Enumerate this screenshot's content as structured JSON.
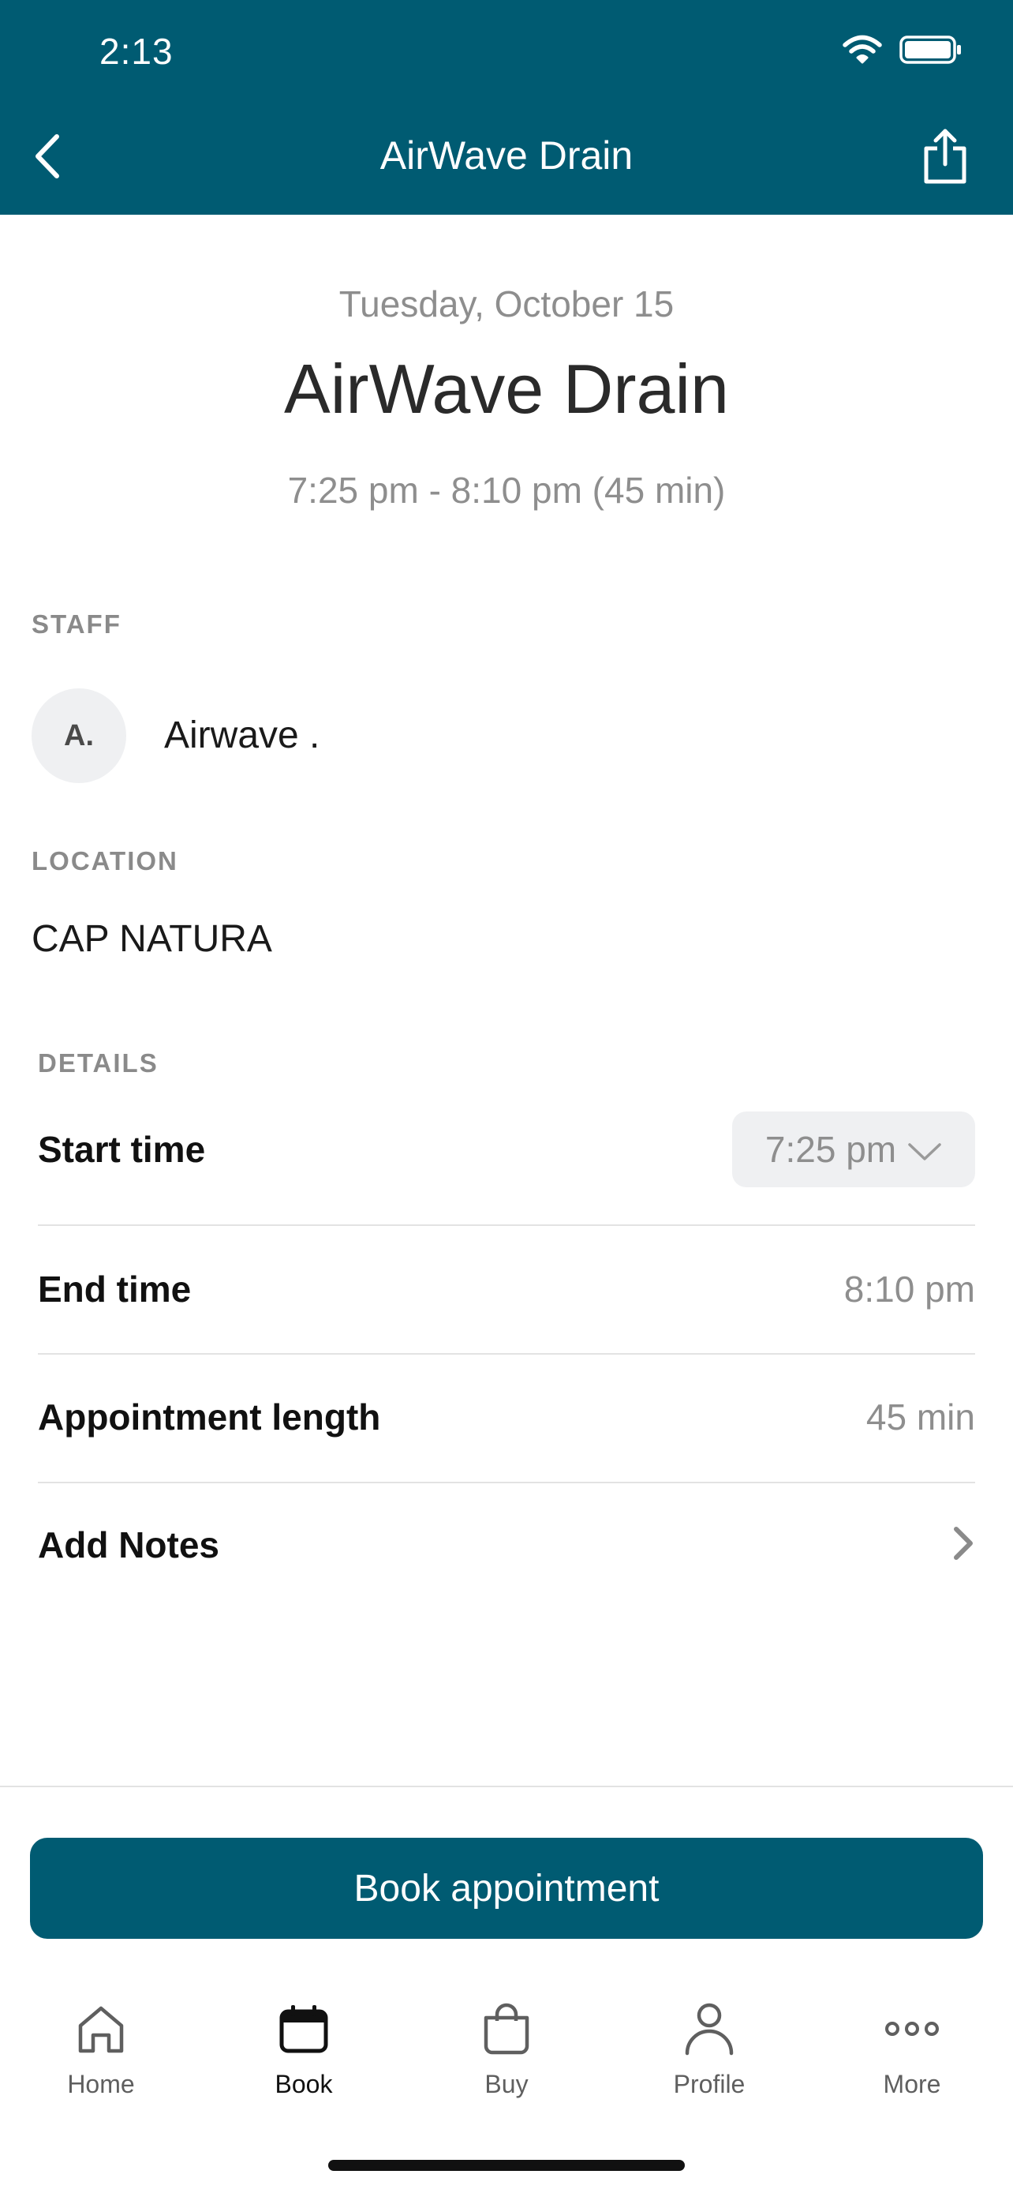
{
  "status_bar": {
    "time": "2:13"
  },
  "nav": {
    "title": "AirWave Drain"
  },
  "summary": {
    "date": "Tuesday, October 15",
    "service": "AirWave Drain",
    "time_range": "7:25 pm - 8:10 pm (45 min)"
  },
  "staff": {
    "label": "STAFF",
    "initials": "A.",
    "name": "Airwave ."
  },
  "location": {
    "label": "LOCATION",
    "name": "CAP NATURA"
  },
  "details": {
    "label": "DETAILS",
    "start_time": {
      "label": "Start time",
      "value": "7:25 pm"
    },
    "end_time": {
      "label": "End time",
      "value": "8:10 pm"
    },
    "length": {
      "label": "Appointment length",
      "value": "45 min"
    },
    "notes": {
      "label": "Add Notes"
    }
  },
  "actions": {
    "book_label": "Book appointment"
  },
  "tabs": [
    {
      "label": "Home",
      "icon": "home-icon",
      "active": false
    },
    {
      "label": "Book",
      "icon": "calendar-icon",
      "active": true
    },
    {
      "label": "Buy",
      "icon": "shopping-bag-icon",
      "active": false
    },
    {
      "label": "Profile",
      "icon": "person-icon",
      "active": false
    },
    {
      "label": "More",
      "icon": "more-dots-icon",
      "active": false
    }
  ],
  "colors": {
    "brand": "#005b72",
    "muted_text": "#8e8e8e",
    "chip_bg": "#eff0f2"
  }
}
